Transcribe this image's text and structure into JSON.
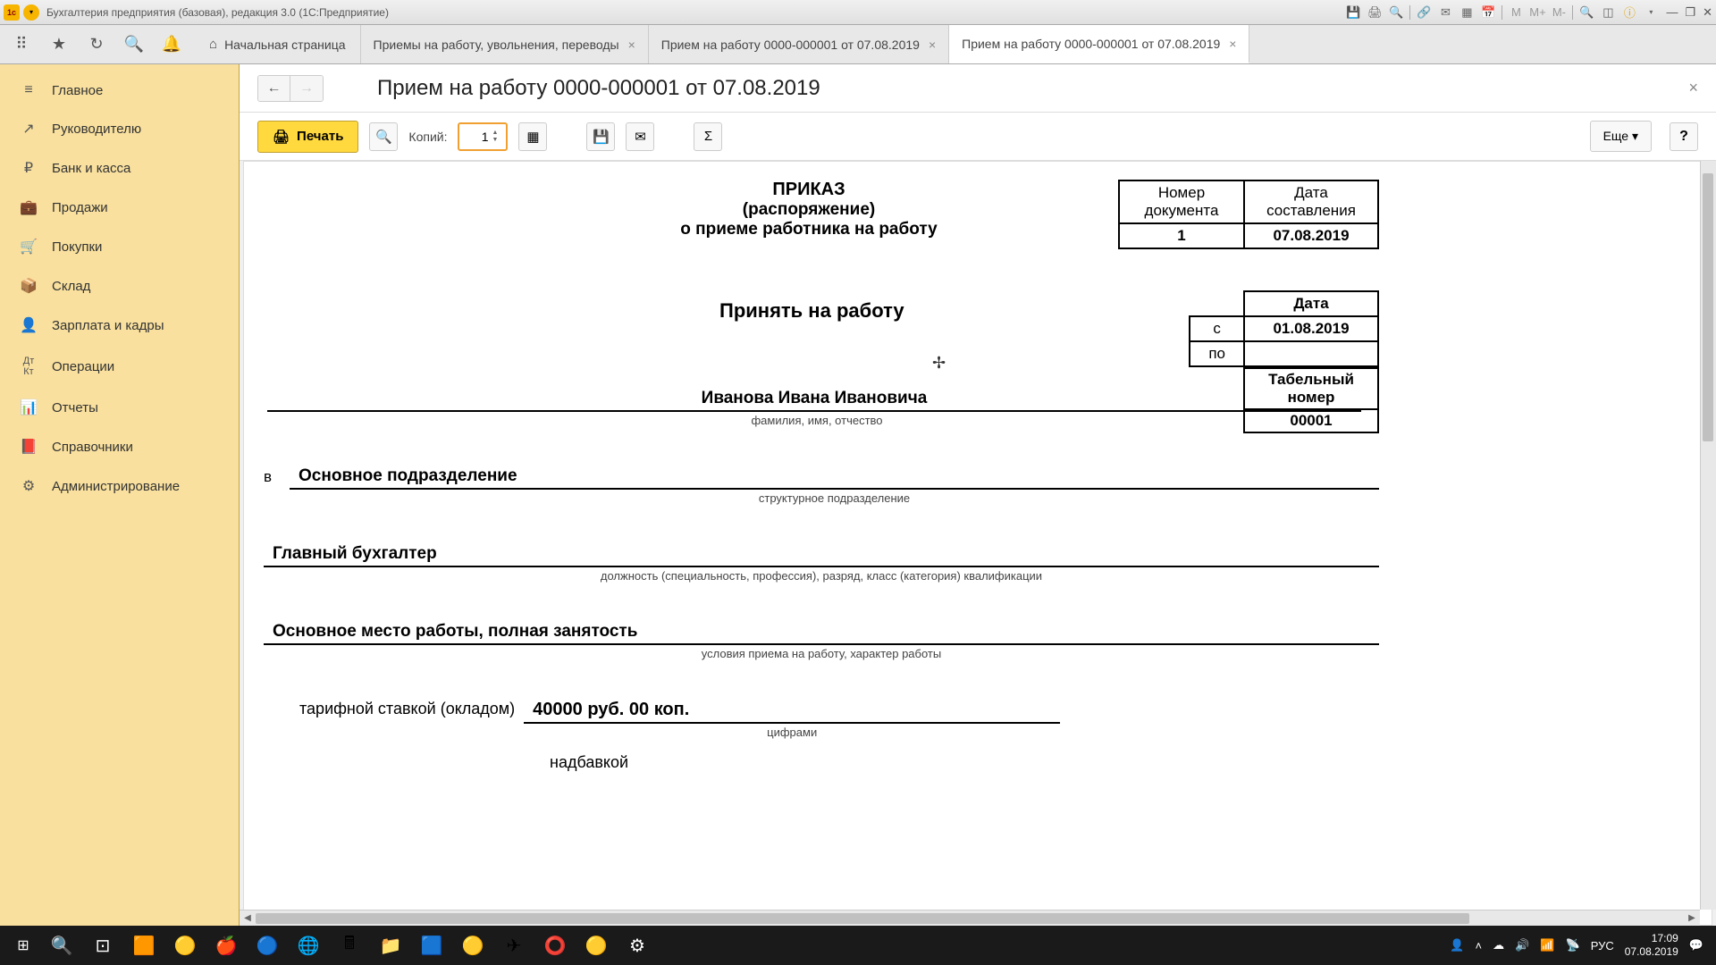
{
  "title_bar": {
    "app_title": "Бухгалтерия предприятия (базовая), редакция 3.0  (1С:Предприятие)"
  },
  "tabs": {
    "home": "Начальная страница",
    "t1": "Приемы на работу, увольнения, переводы",
    "t2": "Прием на работу 0000-000001 от 07.08.2019",
    "t3": "Прием на работу 0000-000001 от 07.08.2019"
  },
  "sidebar": {
    "main": "Главное",
    "manager": "Руководителю",
    "bank": "Банк и касса",
    "sales": "Продажи",
    "purchases": "Покупки",
    "warehouse": "Склад",
    "salary": "Зарплата и кадры",
    "operations": "Операции",
    "reports": "Отчеты",
    "refs": "Справочники",
    "admin": "Администрирование"
  },
  "content": {
    "heading": "Прием на работу 0000-000001 от 07.08.2019",
    "print_btn": "Печать",
    "copies_label": "Копий:",
    "copies_value": "1",
    "more_btn": "Еще",
    "help_btn": "?"
  },
  "document": {
    "doc_num_label": "Номер документа",
    "doc_num": "1",
    "doc_date_label": "Дата составления",
    "doc_date": "07.08.2019",
    "order": "ПРИКАЗ",
    "order_sub": "(распоряжение)",
    "order_about": "о приеме работника на работу",
    "accept": "Принять на работу",
    "date_label": "Дата",
    "from_label": "с",
    "to_label": "по",
    "date_from": "01.08.2019",
    "tab_num_label": "Табельный номер",
    "tab_num": "00001",
    "person_name": "Иванова Ивана Ивановича",
    "fio_label": "фамилия, имя, отчество",
    "in_label": "в",
    "department": "Основное подразделение",
    "dept_sub": "структурное подразделение",
    "position": "Главный бухгалтер",
    "position_sub": "должность (специальность, профессия), разряд, класс (категория) квалификации",
    "conditions": "Основное место работы, полная занятость",
    "conditions_sub": "условия приема на работу, характер работы",
    "salary_label": "тарифной ставкой (окладом)",
    "salary_value": "40000 руб. 00 коп.",
    "salary_sub": "цифрами",
    "bonus_label": "надбавкой"
  },
  "taskbar": {
    "lang": "РУС",
    "time": "17:09",
    "date": "07.08.2019"
  }
}
